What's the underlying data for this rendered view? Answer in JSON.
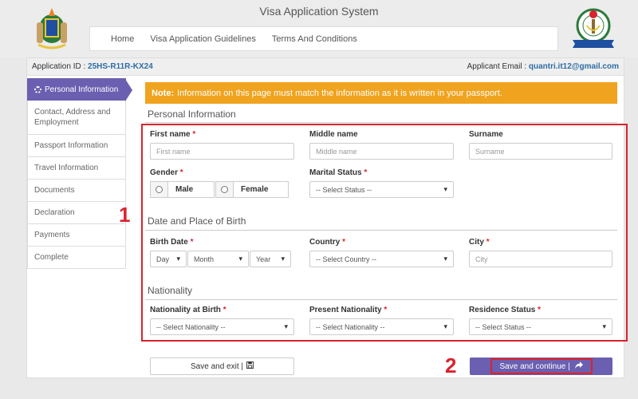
{
  "header": {
    "title": "Visa Application System",
    "nav": [
      "Home",
      "Visa Application Guidelines",
      "Terms And Conditions"
    ]
  },
  "infobar": {
    "app_id_label": "Application ID :",
    "app_id": "25HS-R11R-KX24",
    "email_label": "Applicant Email :",
    "email": "quantri.it12@gmail.com"
  },
  "sidebar": {
    "items": [
      "Personal Information",
      "Contact, Address and Employment",
      "Passport Information",
      "Travel Information",
      "Documents",
      "Declaration",
      "Payments",
      "Complete"
    ]
  },
  "note": {
    "label": "Note:",
    "text": "Information on this page must match the information as it is written in your passport."
  },
  "personal": {
    "title": "Personal Information",
    "first_name_label": "First name",
    "first_name_placeholder": "First name",
    "middle_name_label": "Middle name",
    "middle_name_placeholder": "Middle name",
    "surname_label": "Surname",
    "surname_placeholder": "Surname",
    "gender_label": "Gender",
    "gender_male": "Male",
    "gender_female": "Female",
    "marital_label": "Marital Status",
    "marital_value": "-- Select Status --"
  },
  "birth": {
    "title": "Date and Place of Birth",
    "date_label": "Birth Date",
    "day": "Day",
    "month": "Month",
    "year": "Year",
    "country_label": "Country",
    "country_value": "-- Select Country --",
    "city_label": "City",
    "city_placeholder": "City"
  },
  "nationality": {
    "title": "Nationality",
    "birth_label": "Nationality at Birth",
    "birth_value": "-- Select Nationality --",
    "present_label": "Present Nationality",
    "present_value": "-- Select Nationality --",
    "residence_label": "Residence Status",
    "residence_value": "-- Select Status --"
  },
  "buttons": {
    "save_exit": "Save and exit |",
    "save_continue": "Save and continue |"
  },
  "markers": {
    "one": "1",
    "two": "2"
  },
  "required_mark": "*"
}
